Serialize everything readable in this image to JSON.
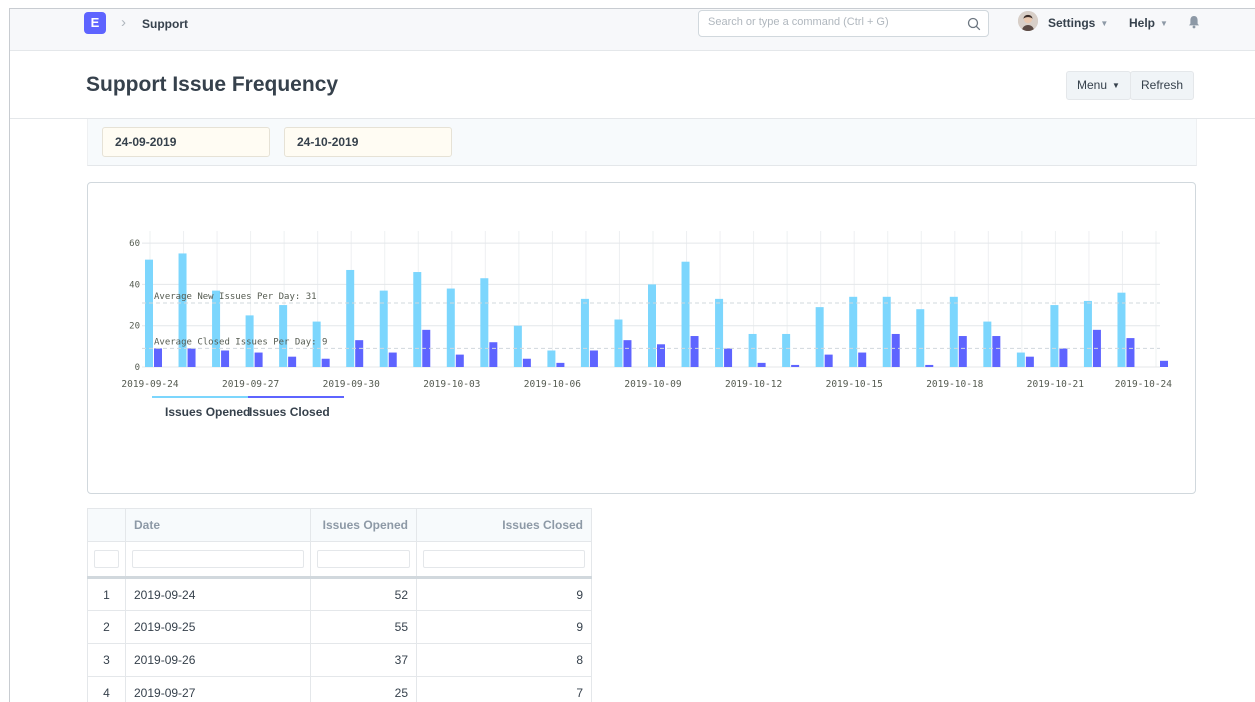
{
  "navbar": {
    "logo_letter": "E",
    "breadcrumb": "Support",
    "search_placeholder": "Search or type a command (Ctrl + G)",
    "settings_label": "Settings",
    "help_label": "Help"
  },
  "page": {
    "title": "Support Issue Frequency",
    "menu_label": "Menu",
    "refresh_label": "Refresh"
  },
  "filters": {
    "from_date": "24-09-2019",
    "to_date": "24-10-2019"
  },
  "colors": {
    "opened": "#7cd6fd",
    "closed": "#5e64ff",
    "accent": "#5e64ff"
  },
  "chart_data": {
    "type": "bar",
    "categories": [
      "2019-09-24",
      "2019-09-25",
      "2019-09-26",
      "2019-09-27",
      "2019-09-28",
      "2019-09-29",
      "2019-09-30",
      "2019-10-01",
      "2019-10-02",
      "2019-10-03",
      "2019-10-04",
      "2019-10-05",
      "2019-10-06",
      "2019-10-07",
      "2019-10-08",
      "2019-10-09",
      "2019-10-10",
      "2019-10-11",
      "2019-10-12",
      "2019-10-13",
      "2019-10-14",
      "2019-10-15",
      "2019-10-16",
      "2019-10-17",
      "2019-10-18",
      "2019-10-19",
      "2019-10-20",
      "2019-10-21",
      "2019-10-22",
      "2019-10-23",
      "2019-10-24"
    ],
    "x_tick_labels": [
      "2019-09-24",
      "2019-09-27",
      "2019-09-30",
      "2019-10-03",
      "2019-10-06",
      "2019-10-09",
      "2019-10-12",
      "2019-10-15",
      "2019-10-18",
      "2019-10-21",
      "2019-10-24"
    ],
    "series": [
      {
        "name": "Issues Opened",
        "values": [
          52,
          55,
          37,
          25,
          30,
          22,
          47,
          37,
          46,
          38,
          43,
          20,
          8,
          33,
          23,
          40,
          51,
          33,
          16,
          16,
          29,
          34,
          34,
          28,
          34,
          22,
          7,
          30,
          32,
          36,
          0
        ]
      },
      {
        "name": "Issues Closed",
        "values": [
          9,
          9,
          8,
          7,
          5,
          4,
          13,
          7,
          18,
          6,
          12,
          4,
          2,
          8,
          13,
          11,
          15,
          9,
          2,
          1,
          6,
          7,
          16,
          1,
          15,
          15,
          5,
          9,
          18,
          14,
          3
        ]
      }
    ],
    "y_ticks": [
      0,
      20,
      40,
      60
    ],
    "ylim": [
      0,
      62
    ],
    "grid": true,
    "legend": "bottom-left",
    "annotations": [
      {
        "label": "Average New Issues Per Day: 31",
        "value": 31
      },
      {
        "label": "Average Closed Issues Per Day: 9",
        "value": 9
      }
    ]
  },
  "table": {
    "columns": [
      "Date",
      "Issues Opened",
      "Issues Closed"
    ],
    "rows": [
      {
        "n": "1",
        "date": "2019-09-24",
        "opened": "52",
        "closed": "9"
      },
      {
        "n": "2",
        "date": "2019-09-25",
        "opened": "55",
        "closed": "9"
      },
      {
        "n": "3",
        "date": "2019-09-26",
        "opened": "37",
        "closed": "8"
      },
      {
        "n": "4",
        "date": "2019-09-27",
        "opened": "25",
        "closed": "7"
      }
    ]
  }
}
